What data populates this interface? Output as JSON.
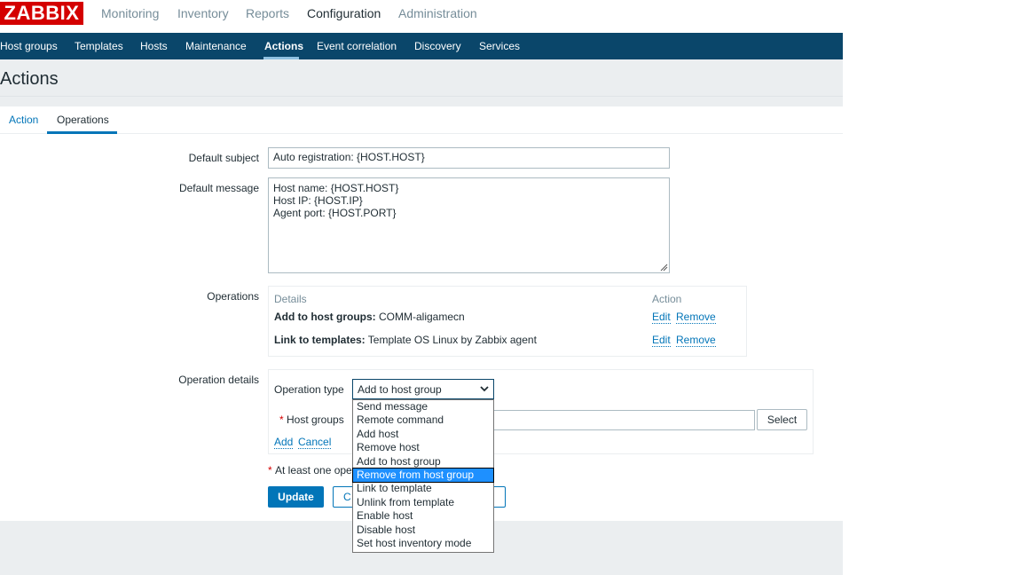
{
  "brand": {
    "logo": "ZABBIX",
    "logo_color": "#d40000"
  },
  "top_menu": [
    "Monitoring",
    "Inventory",
    "Reports",
    "Configuration",
    "Administration"
  ],
  "top_menu_active": "Configuration",
  "sub_menu": [
    "Host groups",
    "Templates",
    "Hosts",
    "Maintenance",
    "Actions",
    "Event correlation",
    "Discovery",
    "Services"
  ],
  "sub_menu_active": "Actions",
  "colors": {
    "subnav_bg": "#0a466a",
    "accent": "#0275b8",
    "header_bg": "#ebeef0"
  },
  "page": {
    "title": "Actions"
  },
  "tabs": [
    "Action",
    "Operations"
  ],
  "tabs_active": "Operations",
  "form": {
    "default_subject_label": "Default subject",
    "default_subject_value": "Auto registration: {HOST.HOST}",
    "default_message_label": "Default message",
    "default_message_lines": [
      "Host name: {HOST.HOST}",
      "Host IP: {HOST.IP}",
      "Agent port: {HOST.PORT}"
    ],
    "operations_label": "Operations",
    "operations_table": {
      "col_details": "Details",
      "col_action": "Action",
      "rows": [
        {
          "key": "Add to host groups:",
          "value": " COMM-aligamecn",
          "edit": "Edit",
          "remove": "Remove"
        },
        {
          "key": "Link to templates:",
          "value": " Template OS Linux by Zabbix agent",
          "edit": "Edit",
          "remove": "Remove"
        }
      ]
    },
    "operation_details_label": "Operation details",
    "operation_type_label": "Operation type",
    "operation_type_value": "Add to host group",
    "host_groups_required": "*",
    "host_groups_label": "Host groups",
    "select_button": "Select",
    "add_link": "Add",
    "cancel_link": "Cancel",
    "required_note_star": "*",
    "required_note": "At least one ope",
    "update_button": "Update",
    "clone_button_partial": "C"
  },
  "dropdown_options": [
    "Send message",
    "Remote command",
    "Add host",
    "Remove host",
    "Add to host group",
    "Remove from host group",
    "Link to template",
    "Unlink from template",
    "Enable host",
    "Disable host",
    "Set host inventory mode"
  ],
  "dropdown_highlighted": "Remove from host group"
}
